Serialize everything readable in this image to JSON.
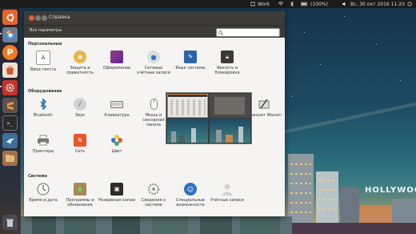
{
  "topbar": {
    "keyboard_layout": "Work",
    "battery": "(100%)",
    "datetime": "Вс, 30 окт 2016 11:20",
    "icons": [
      "keyboard-icon",
      "network-icon",
      "bluetooth-icon",
      "battery-icon",
      "volume-icon",
      "settings-gear-icon"
    ]
  },
  "launcher": {
    "items": [
      {
        "name": "dash-home",
        "icon": "ubuntu-logo-icon"
      },
      {
        "name": "chromium",
        "icon": "chromium-icon"
      },
      {
        "name": "app-p",
        "icon": "p-app-icon"
      },
      {
        "name": "ubuntu-software",
        "icon": "software-center-icon"
      },
      {
        "name": "system-settings",
        "icon": "settings-gear-icon"
      },
      {
        "name": "sublime",
        "icon": "sublime-icon"
      },
      {
        "name": "terminal",
        "icon": "terminal-icon"
      },
      {
        "name": "app-bird",
        "icon": "bird-icon"
      },
      {
        "name": "files",
        "icon": "files-icon"
      },
      {
        "name": "trash",
        "icon": "trash-icon"
      }
    ]
  },
  "window": {
    "title": "Справка",
    "all_settings": "Все параметры",
    "search_placeholder": ""
  },
  "sections": {
    "personal": {
      "title": "Персональные",
      "items": [
        {
          "label": "Ввод текста",
          "icon": "keyboard-input-icon"
        },
        {
          "label": "Защита и приватность",
          "icon": "privacy-icon"
        },
        {
          "label": "Оформление",
          "icon": "appearance-icon"
        },
        {
          "label": "Сетевые учётные записи",
          "icon": "online-accounts-icon"
        },
        {
          "label": "Язык системы",
          "icon": "language-icon"
        },
        {
          "label": "Яркость и блокировка",
          "icon": "brightness-lock-icon"
        }
      ]
    },
    "hardware": {
      "title": "Оборудование",
      "items": [
        {
          "label": "Bluetooth",
          "icon": "bluetooth-icon"
        },
        {
          "label": "Звук",
          "icon": "sound-icon"
        },
        {
          "label": "Клавиатура",
          "icon": "keyboard-icon"
        },
        {
          "label": "Мышь и сенсорная панель",
          "icon": "mouse-icon"
        },
        {
          "label": "Планшет Wacom",
          "icon": "wacom-icon"
        },
        {
          "label": "Принтеры",
          "icon": "printer-icon"
        },
        {
          "label": "Сеть",
          "icon": "network-icon"
        },
        {
          "label": "Цвет",
          "icon": "color-icon"
        }
      ]
    },
    "system": {
      "title": "Система",
      "items": [
        {
          "label": "Время и дата",
          "icon": "clock-icon"
        },
        {
          "label": "Программы и обновления",
          "icon": "software-updates-icon"
        },
        {
          "label": "Резервные копии",
          "icon": "backup-icon"
        },
        {
          "label": "Сведения о системе",
          "icon": "system-details-icon"
        },
        {
          "label": "Специальные возможности",
          "icon": "accessibility-icon"
        },
        {
          "label": "Учётные записи",
          "icon": "user-accounts-icon"
        }
      ]
    }
  },
  "wallpaper": {
    "sign_text": "HOLLYWOOD"
  },
  "colors": {
    "accent": "#e07d3c",
    "panel": "#3c3b37",
    "close_button": "#e05a2b"
  }
}
